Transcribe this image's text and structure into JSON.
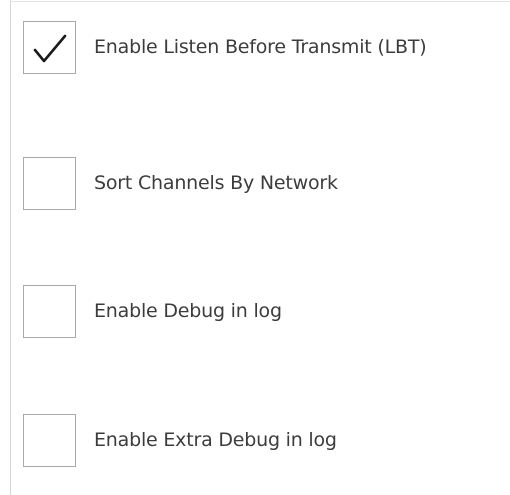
{
  "options": [
    {
      "label": "Enable Listen Before Transmit (LBT)",
      "checked": true,
      "icon": "checkmark-icon"
    },
    {
      "label": "Sort Channels By Network",
      "checked": false
    },
    {
      "label": "Enable Debug in log",
      "checked": false
    },
    {
      "label": "Enable Extra Debug in log",
      "checked": false
    }
  ],
  "colors": {
    "text": "#3c3c3c",
    "checkbox_border": "#a9a9a9",
    "check_mark": "#1a1a1a",
    "background": "#ffffff"
  }
}
